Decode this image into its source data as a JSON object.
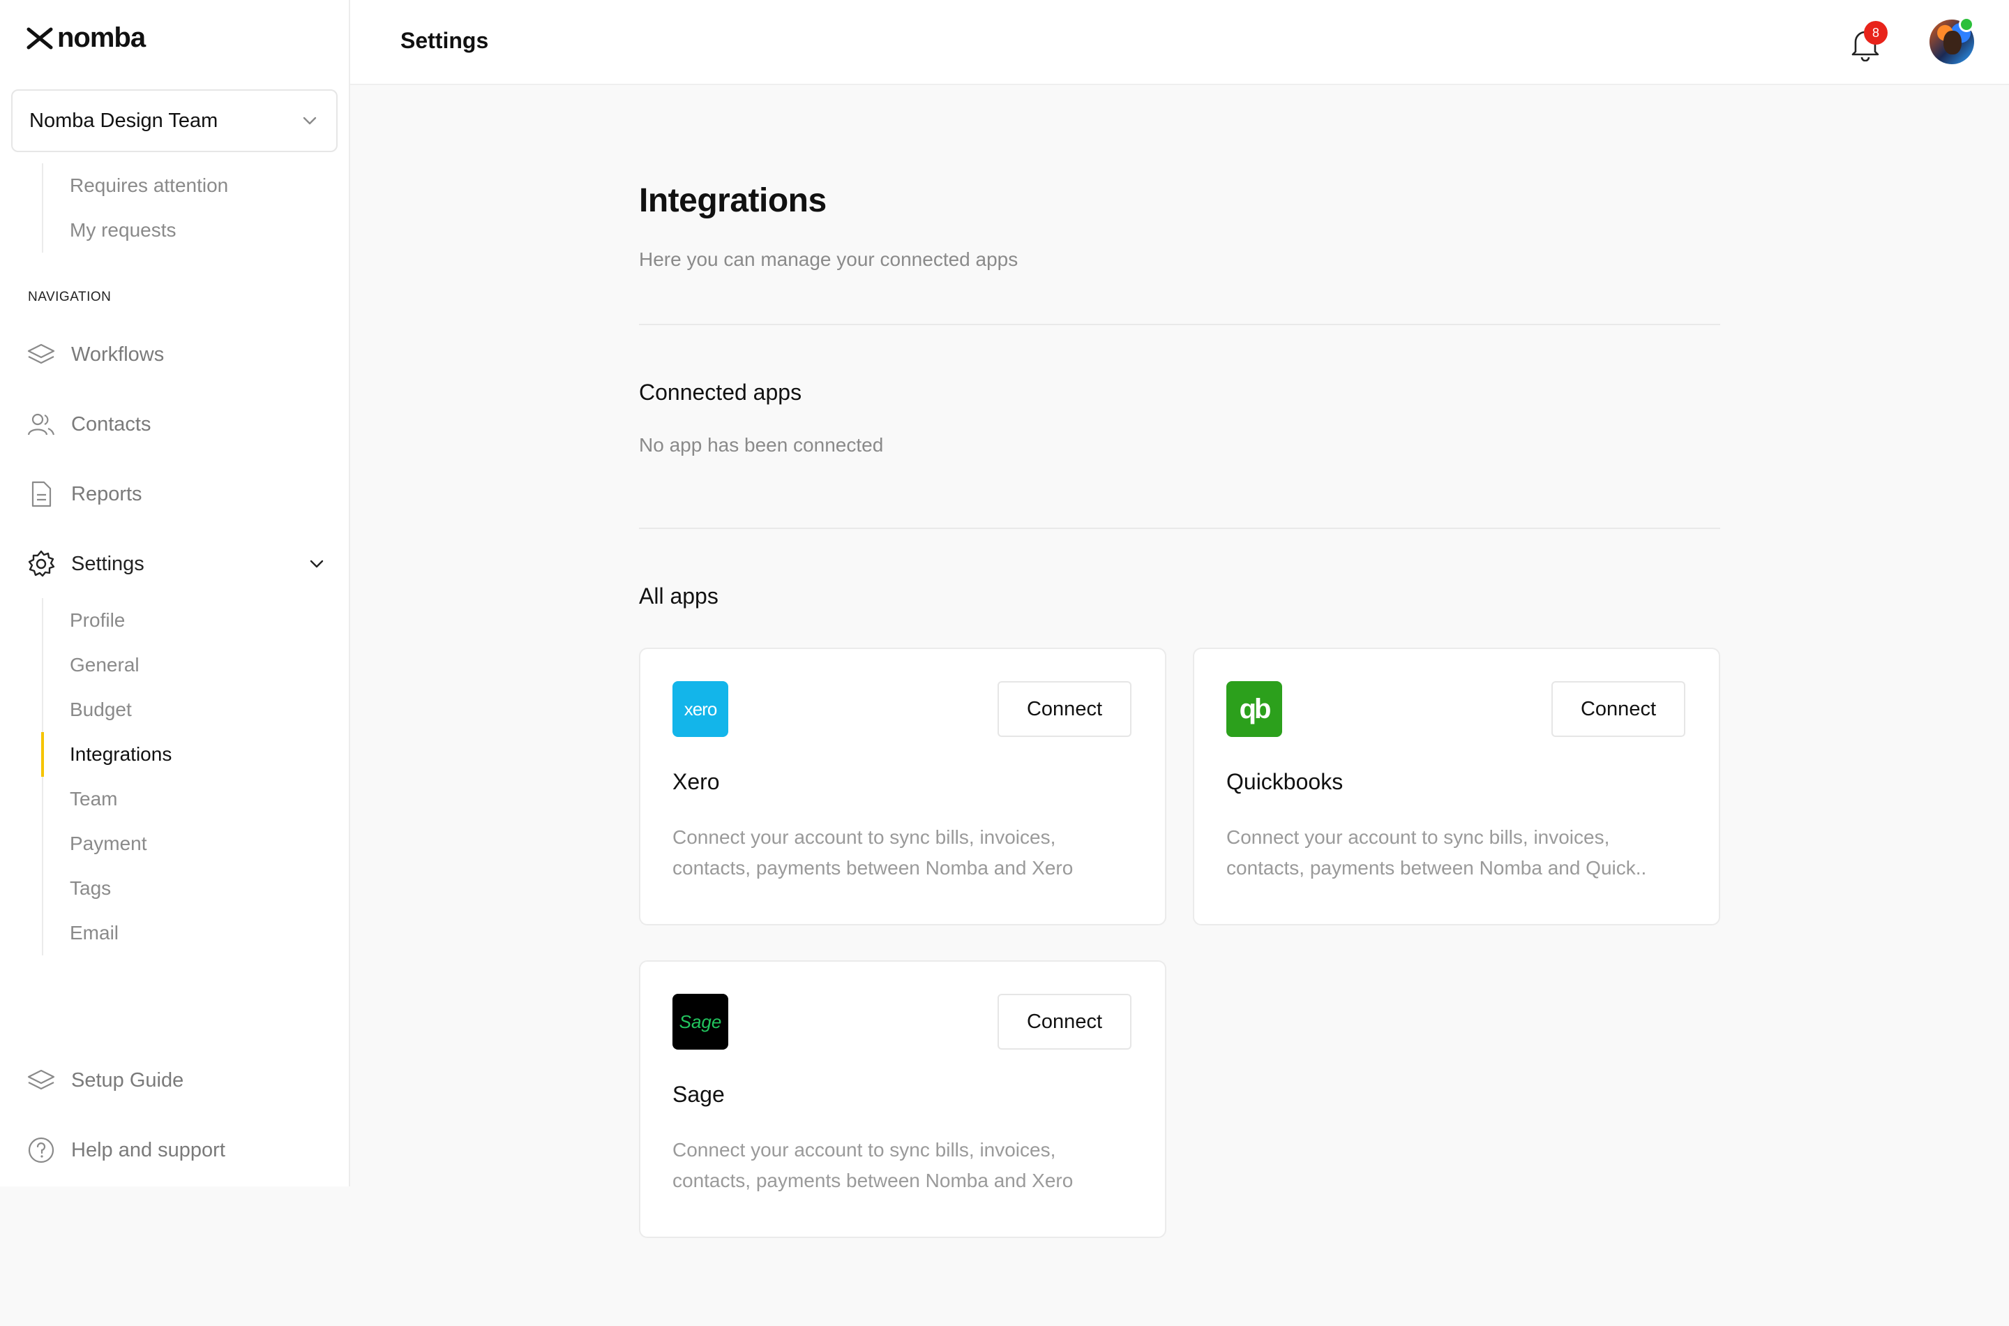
{
  "brand": {
    "name": "nomba"
  },
  "team_select": {
    "label": "Nomba Design Team"
  },
  "requests": [
    {
      "label": "Requires attention"
    },
    {
      "label": "My requests"
    }
  ],
  "navigation": {
    "label": "NAVIGATION",
    "items": [
      {
        "label": "Workflows",
        "icon": "layers-icon"
      },
      {
        "label": "Contacts",
        "icon": "users-icon"
      },
      {
        "label": "Reports",
        "icon": "document-icon"
      },
      {
        "label": "Settings",
        "icon": "gear-icon"
      }
    ]
  },
  "settings_sub": [
    {
      "label": "Profile"
    },
    {
      "label": "General"
    },
    {
      "label": "Budget"
    },
    {
      "label": "Integrations",
      "active": true
    },
    {
      "label": "Team"
    },
    {
      "label": "Payment"
    },
    {
      "label": "Tags"
    },
    {
      "label": "Email"
    }
  ],
  "footer_nav": [
    {
      "label": "Setup Guide",
      "icon": "layers-icon"
    },
    {
      "label": "Help and support",
      "icon": "help-icon"
    }
  ],
  "header": {
    "title": "Settings",
    "notification_count": "8"
  },
  "page": {
    "title": "Integrations",
    "subtitle": "Here you can manage your connected apps",
    "connected": {
      "heading": "Connected apps",
      "empty": "No app has been connected"
    },
    "all_apps_heading": "All apps",
    "apps": [
      {
        "name": "Xero",
        "logo_text": "xero",
        "logo_color": "#13b5ea",
        "button": "Connect",
        "description": "Connect your account to sync bills, invoices, contacts, payments between Nomba and Xero"
      },
      {
        "name": "Quickbooks",
        "logo_text": "qb",
        "logo_color": "#2ca01c",
        "button": "Connect",
        "description": "Connect your account to sync bills, invoices, contacts, payments between Nomba and Quick.."
      },
      {
        "name": "Sage",
        "logo_text": "Sage",
        "logo_color": "#000000",
        "button": "Connect",
        "description": "Connect your account to sync bills, invoices, contacts, payments between Nomba and Xero"
      }
    ]
  }
}
